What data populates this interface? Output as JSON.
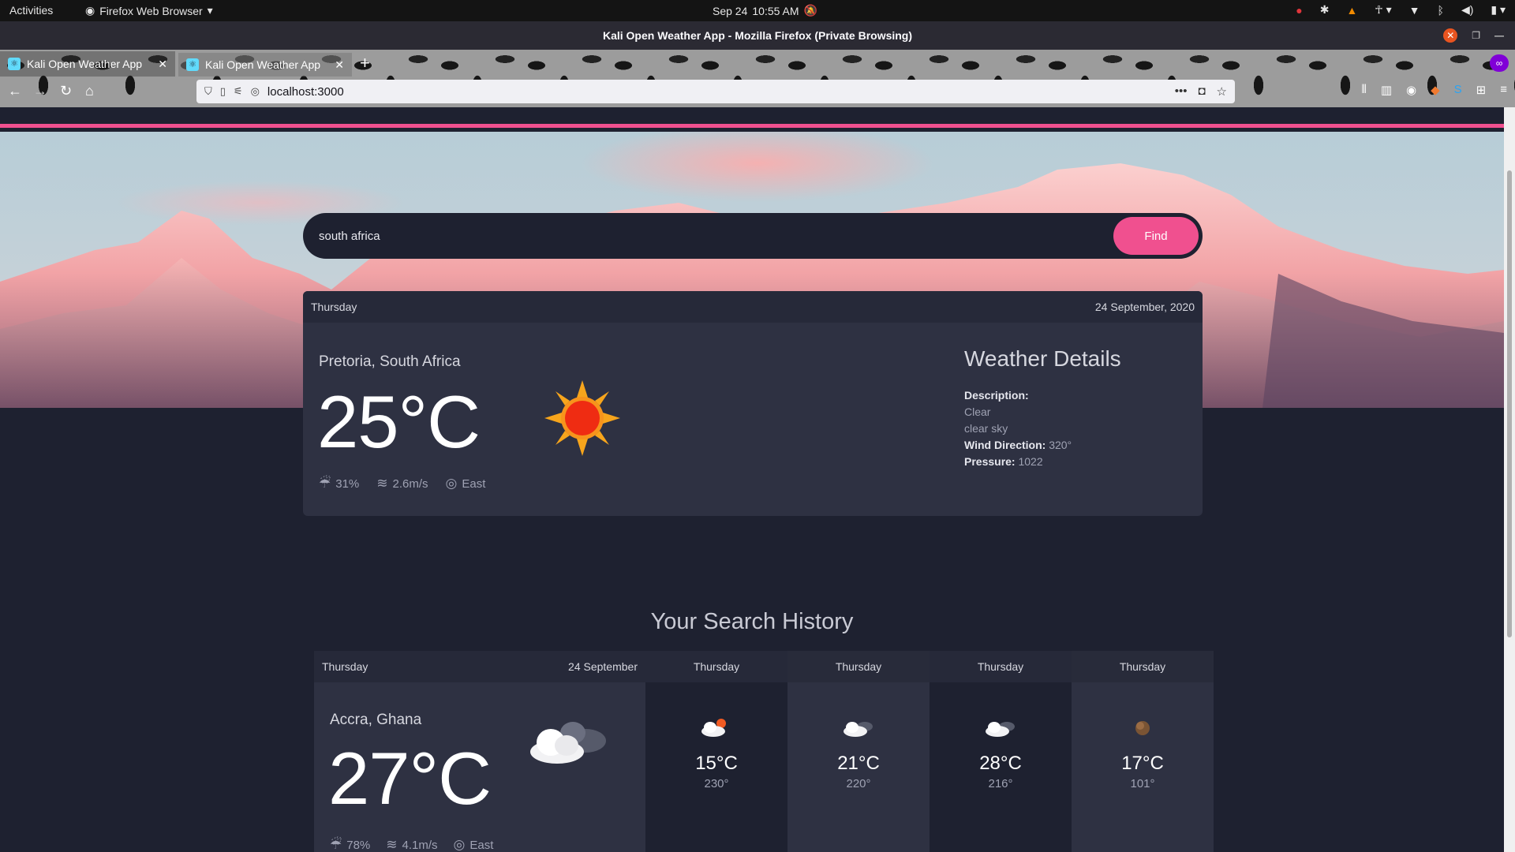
{
  "os_bar": {
    "activities": "Activities",
    "app_menu": "Firefox Web Browser",
    "date": "Sep 24",
    "time": "10:55 AM"
  },
  "window": {
    "title": "Kali Open Weather App - Mozilla Firefox (Private Browsing)"
  },
  "tabs": [
    {
      "label": "Kali Open Weather App"
    },
    {
      "label": "Kali Open Weather App"
    }
  ],
  "address_bar": {
    "url": "localhost:3000"
  },
  "search": {
    "value": "south africa",
    "button": "Find"
  },
  "current": {
    "day": "Thursday",
    "date": "24 September, 2020",
    "city": "Pretoria, South Africa",
    "temperature": "25°C",
    "humidity": "31%",
    "wind_speed": "2.6m/s",
    "direction": "East",
    "details": {
      "heading": "Weather Details",
      "description_label": "Description:",
      "description_main": "Clear",
      "description_sub": "clear sky",
      "wind_direction_label": "Wind Direction:",
      "wind_direction_value": "320°",
      "pressure_label": "Pressure:",
      "pressure_value": "1022"
    }
  },
  "history": {
    "title": "Your Search History",
    "main": {
      "day": "Thursday",
      "date": "24 September",
      "city": "Accra, Ghana",
      "temperature": "27°C",
      "humidity": "78%",
      "wind_speed": "4.1m/s",
      "direction": "East"
    },
    "items": [
      {
        "day": "Thursday",
        "temperature": "15°C",
        "degree": "230°",
        "icon": "partly-cloudy-sun-icon"
      },
      {
        "day": "Thursday",
        "temperature": "21°C",
        "degree": "220°",
        "icon": "cloud-icon"
      },
      {
        "day": "Thursday",
        "temperature": "28°C",
        "degree": "216°",
        "icon": "cloud-icon"
      },
      {
        "day": "Thursday",
        "temperature": "17°C",
        "degree": "101°",
        "icon": "moon-icon"
      }
    ]
  },
  "colors": {
    "accent": "#f0508f",
    "background": "#1e2130",
    "card": "#2e3142"
  }
}
